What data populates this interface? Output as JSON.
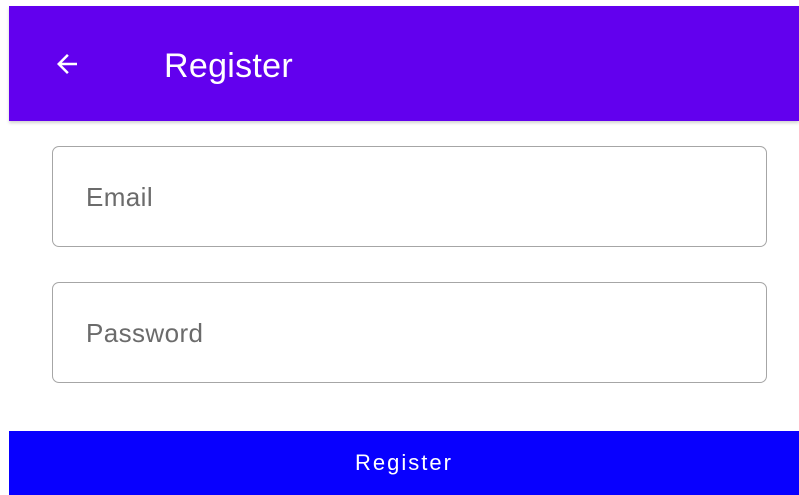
{
  "colors": {
    "app_bar": "#6200ee",
    "primary_button": "#0800ff",
    "on_primary": "#ffffff",
    "field_border": "#a6a6a6",
    "hint_text": "#6b6b6b"
  },
  "app_bar": {
    "back_icon": "arrow-left-icon",
    "title": "Register"
  },
  "form": {
    "email": {
      "placeholder": "Email",
      "value": ""
    },
    "password": {
      "placeholder": "Password",
      "value": ""
    }
  },
  "actions": {
    "register_label": "Register"
  }
}
